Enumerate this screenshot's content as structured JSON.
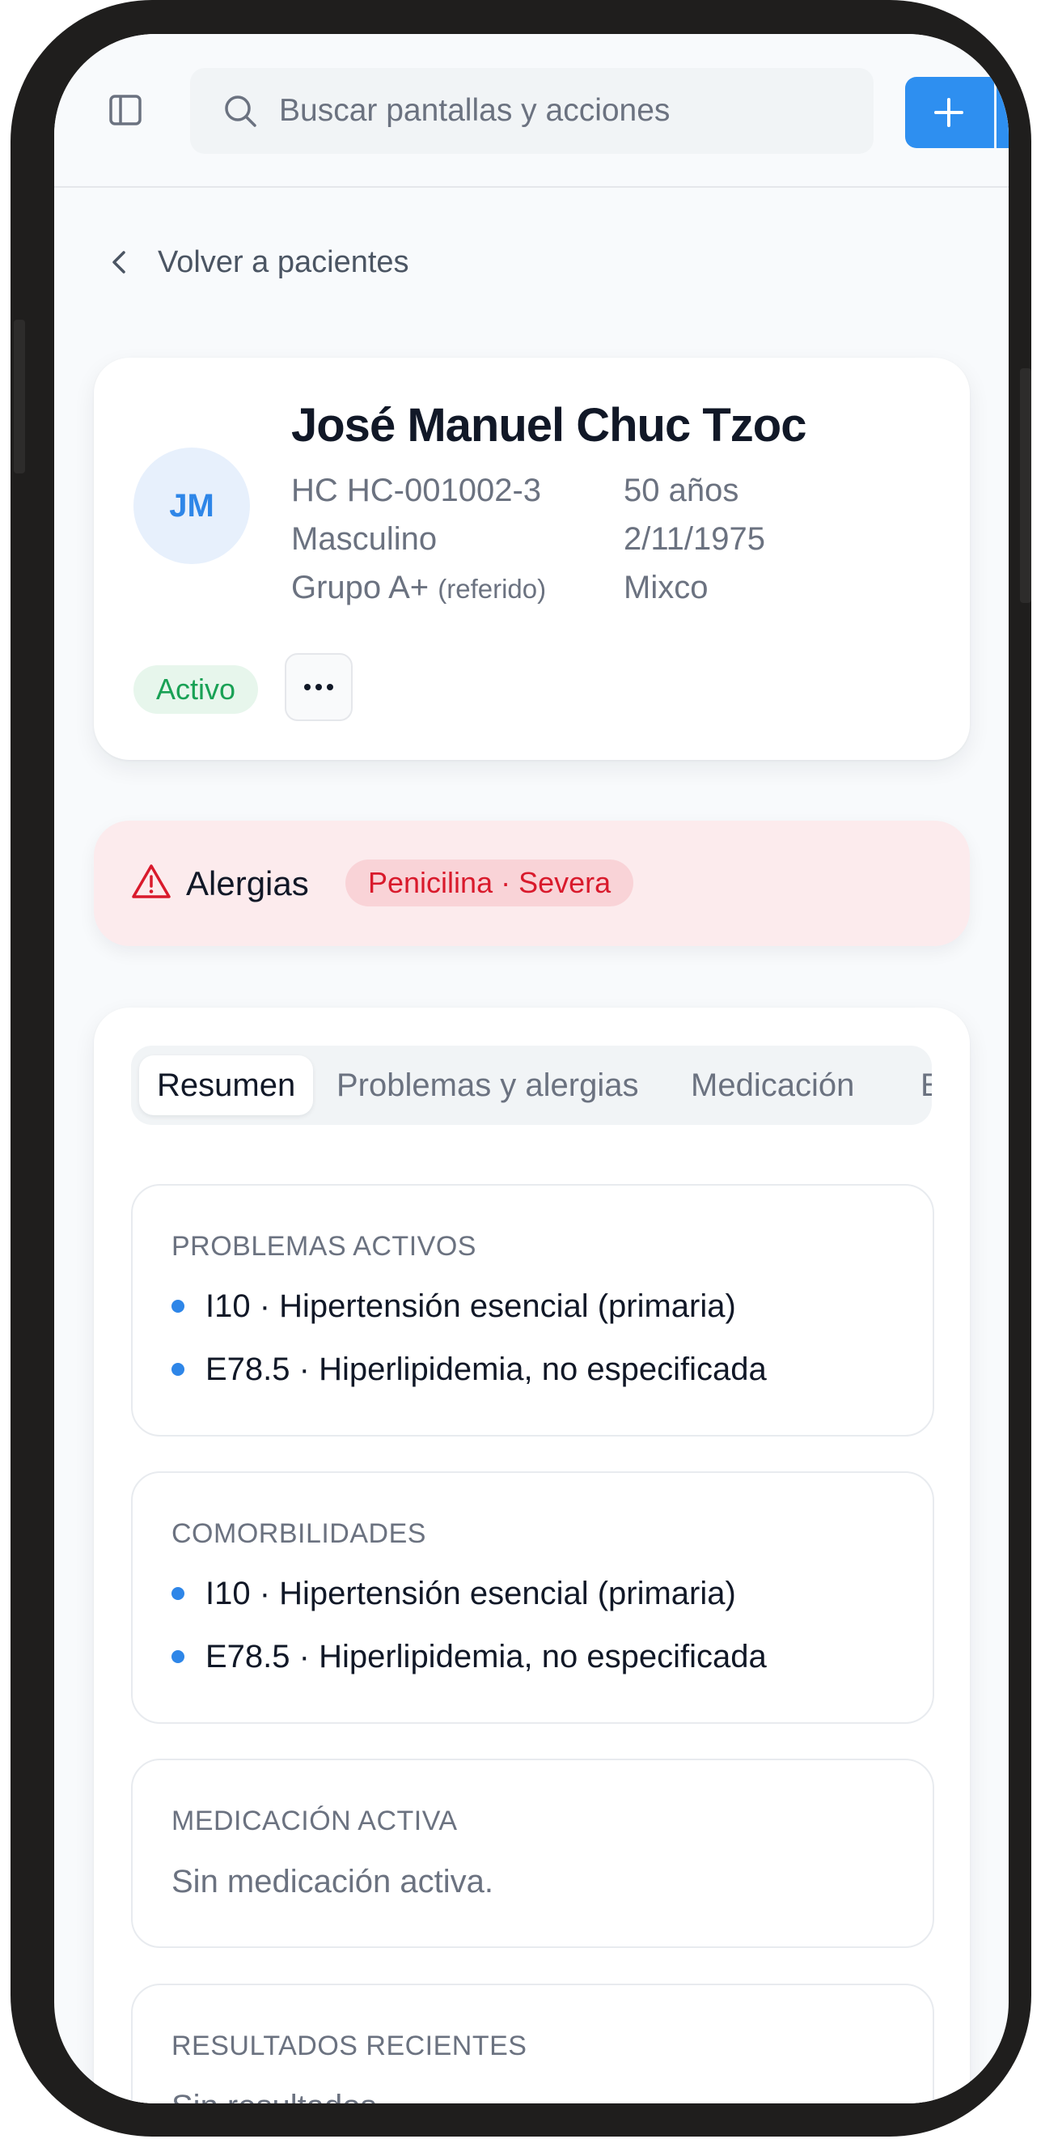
{
  "topbar": {
    "search_placeholder": "Buscar pantallas y acciones"
  },
  "back_link": {
    "label": "Volver a pacientes"
  },
  "patient": {
    "initials": "JM",
    "name": "José Manuel Chuc Tzoc",
    "record": "HC HC-001002-3",
    "age": "50 años",
    "sex": "Masculino",
    "birthdate": "2/11/1975",
    "blood_group": "Grupo A+",
    "blood_group_note": "(referido)",
    "municipality": "Mixco",
    "status": "Activo",
    "status_color": "#19a155"
  },
  "allergies": {
    "title": "Alergias",
    "badge": "Penicilina · Severa",
    "badge_color": "#d91a2c"
  },
  "tabs": [
    {
      "label": "Resumen",
      "active": true
    },
    {
      "label": "Problemas y alergias",
      "active": false
    },
    {
      "label": "Medicación",
      "active": false
    },
    {
      "label": "E",
      "active": false
    }
  ],
  "sections": {
    "active_problems": {
      "title": "PROBLEMAS ACTIVOS",
      "items": [
        "I10 · Hipertensión esencial (primaria)",
        "E78.5 · Hiperlipidemia, no especificada"
      ]
    },
    "comorbidities": {
      "title": "COMORBILIDADES",
      "items": [
        "I10 · Hipertensión esencial (primaria)",
        "E78.5 · Hiperlipidemia, no especificada"
      ]
    },
    "active_medication": {
      "title": "MEDICACIÓN ACTIVA",
      "empty": "Sin medicación activa."
    },
    "recent_results": {
      "title": "RESULTADOS RECIENTES",
      "empty": "Sin resultados"
    }
  },
  "colors": {
    "accent": "#2e8ff0",
    "dot": "#2e86e8",
    "allergy_bg": "#fcebed"
  },
  "icons": {
    "sidebar_toggle": "sidebar-toggle-icon",
    "search": "search-icon",
    "add": "plus-icon",
    "back": "chevron-left-icon",
    "more": "more-horizontal-icon",
    "warning": "warning-triangle-icon"
  }
}
